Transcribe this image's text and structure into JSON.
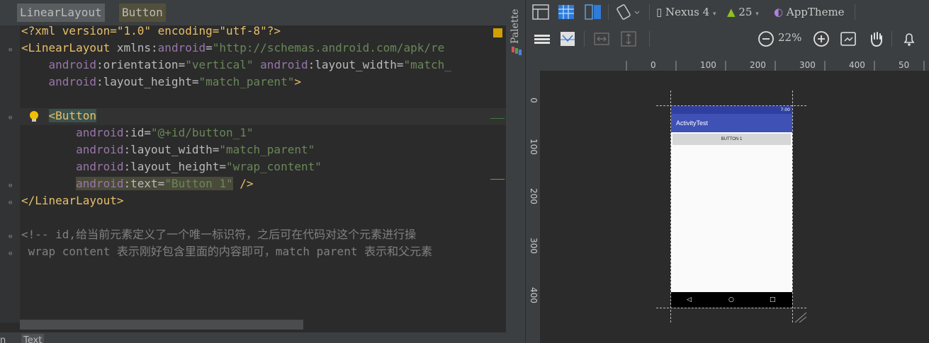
{
  "breadcrumb": [
    "LinearLayout",
    "Button"
  ],
  "code": {
    "line1": "<?xml version=\"1.0\" encoding=\"utf-8\"?>",
    "l2_tag": "<LinearLayout",
    "l2_attr": " xmlns:",
    "l2_ns": "android",
    "l2_eq": "=",
    "l2_val": "\"http://schemas.android.com/apk/re",
    "l3_ns1": "android",
    "l3_attr1": ":orientation=",
    "l3_val1": "\"vertical\"",
    "l3_ns2": "android",
    "l3_attr2": ":layout_width=",
    "l3_val2": "\"match_",
    "l4_ns": "android",
    "l4_attr": ":layout_height=",
    "l4_val": "\"match_parent\"",
    "l4_end": ">",
    "l6_tag": "<Button",
    "l7_ns": "android",
    "l7_attr": ":id=",
    "l7_val": "\"@+id/button_1\"",
    "l8_ns": "android",
    "l8_attr": ":layout_width=",
    "l8_val": "\"match_parent\"",
    "l9_ns": "android",
    "l9_attr": ":layout_height=",
    "l9_val": "\"wrap_content\"",
    "l10_ns": "android",
    "l10_attr": ":text=",
    "l10_val": "\"Button 1\"",
    "l10_end": " />",
    "l11": "</LinearLayout>",
    "l13": "<!-- id,给当前元素定义了一个唯一标识符，之后可在代码对这个元素进行操",
    "l14": " wrap content 表示刚好包含里面的内容即可，match parent 表示和父元素"
  },
  "bottom_tabs": [
    "n",
    "Text"
  ],
  "palette_label": "Palette",
  "toolbar": {
    "device": "Nexus 4",
    "api": "25",
    "theme": "AppTheme",
    "zoom": "22%"
  },
  "ruler_top": [
    "0",
    "100",
    "200",
    "300",
    "400",
    "50"
  ],
  "ruler_left": [
    "0",
    "100",
    "200",
    "300",
    "400"
  ],
  "phone": {
    "status_time": "7:00",
    "app_title": "ActivityTest",
    "button_text": "BUTTON 1",
    "nav_back": "◁",
    "nav_home": "○",
    "nav_recent": "□"
  },
  "colors": {
    "primary_dark": "#303f9f",
    "primary": "#3f51b5",
    "editor_bg": "#2b2b2b"
  }
}
